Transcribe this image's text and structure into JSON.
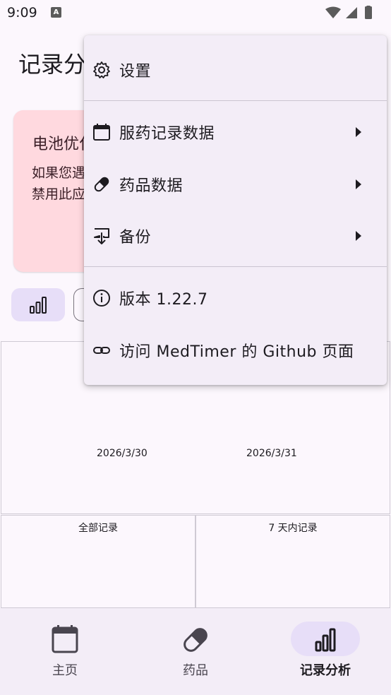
{
  "status_bar": {
    "time": "9:09",
    "notification_icon": "A"
  },
  "header": {
    "title": "记录分析"
  },
  "battery_card": {
    "title": "电池优化",
    "text_line1": "如果您遇",
    "text_line2": "禁用此应"
  },
  "charts": {
    "main_chart": {
      "x_labels": [
        "2026/3/30",
        "2026/3/31"
      ]
    },
    "all_records_title": "全部记录",
    "seven_day_title": "7 天内记录"
  },
  "menu": {
    "items": [
      {
        "label": "设置",
        "icon": "gear-icon"
      },
      {
        "label": "服药记录数据",
        "icon": "calendar-icon",
        "has_submenu": true
      },
      {
        "label": "药品数据",
        "icon": "pill-icon",
        "has_submenu": true
      },
      {
        "label": "备份",
        "icon": "backup-icon",
        "has_submenu": true
      },
      {
        "label": "版本 1.22.7",
        "icon": "info-icon"
      },
      {
        "label": "访问 MedTimer 的 Github 页面",
        "icon": "link-icon"
      }
    ]
  },
  "bottom_nav": {
    "items": [
      {
        "label": "主页",
        "icon": "calendar-icon",
        "active": false
      },
      {
        "label": "药品",
        "icon": "pill-icon",
        "active": false
      },
      {
        "label": "记录分析",
        "icon": "bar-chart-icon",
        "active": true
      }
    ]
  },
  "colors": {
    "background": "#fcf7fd",
    "menu_background": "#f3edf7",
    "battery_card": "#ffd9df",
    "active_pill": "#e7def8"
  }
}
